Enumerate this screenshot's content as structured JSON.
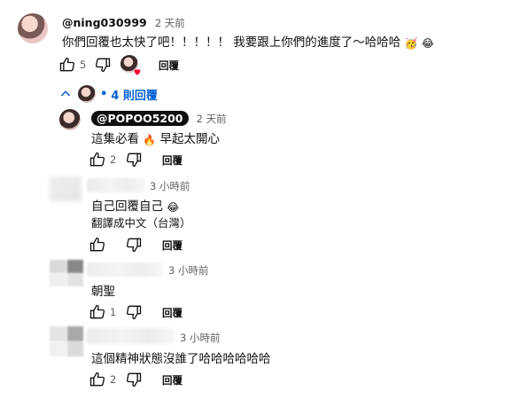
{
  "comment": {
    "handle": "@ning030999",
    "time": "2 天前",
    "text": "你們回覆也太快了吧！！！！！ 我要跟上你們的進度了～哈哈哈",
    "like_count": "5",
    "reply_label": "回覆"
  },
  "replies_toggle": {
    "bullet": "•",
    "label": "4 則回覆"
  },
  "replies": [
    {
      "handle": "@POPOO5200",
      "time": "2 天前",
      "text": "這集必看",
      "text_after": "早起太開心",
      "like_count": "2",
      "reply_label": "回覆"
    },
    {
      "handle": "",
      "time": "3 小時前",
      "text": "自己回覆自己",
      "translate": "翻譯成中文（台灣）",
      "like_count": "",
      "reply_label": "回覆"
    },
    {
      "handle": "",
      "time": "3 小時前",
      "text": "朝聖",
      "like_count": "1",
      "reply_label": "回覆"
    },
    {
      "handle": "",
      "time": "3 小時前",
      "text": "這個精神狀態沒誰了哈哈哈哈哈哈",
      "like_count": "2",
      "reply_label": "回覆"
    }
  ],
  "icons": {
    "like": "thumbs-up-icon",
    "dislike": "thumbs-down-icon",
    "collapse": "chevron-up-icon",
    "heart": "heart-icon",
    "emoji_party": "party-face-emoji",
    "emoji_laugh": "laughing-face-emoji",
    "emoji_fire": "fire-emoji"
  },
  "colors": {
    "link_blue": "#065fd4",
    "text": "#0f0f0f",
    "meta": "#606060",
    "heart": "#ff0033"
  }
}
